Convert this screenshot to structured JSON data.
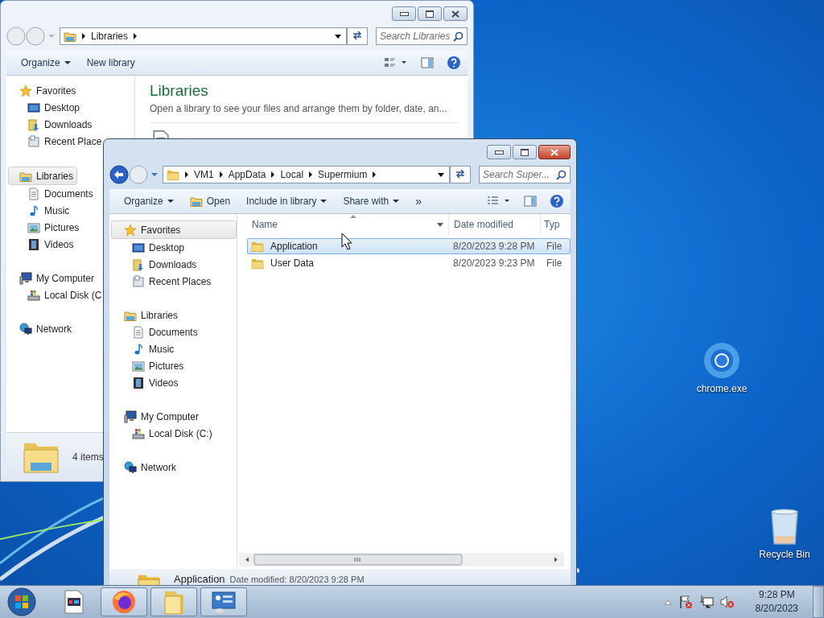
{
  "back_window": {
    "address": {
      "segments": [
        "Libraries"
      ]
    },
    "search": {
      "placeholder": "Search Libraries"
    },
    "toolbar": [
      {
        "label": "Organize",
        "kind": "menu"
      },
      {
        "label": "New library",
        "kind": "plain"
      }
    ],
    "nav": [
      {
        "label": "Favorites",
        "kind": "star",
        "selected": false,
        "children": [
          {
            "label": "Desktop",
            "kind": "desktop",
            "selected": false
          },
          {
            "label": "Downloads",
            "kind": "downloads",
            "selected": false
          },
          {
            "label": "Recent Place",
            "kind": "recent",
            "selected": false
          }
        ]
      },
      {
        "label": "Libraries",
        "kind": "library",
        "selected": true,
        "children": [
          {
            "label": "Documents",
            "kind": "documents",
            "selected": false
          },
          {
            "label": "Music",
            "kind": "music",
            "selected": false
          },
          {
            "label": "Pictures",
            "kind": "pictures",
            "selected": false
          },
          {
            "label": "Videos",
            "kind": "videos",
            "selected": false
          }
        ]
      },
      {
        "label": "My Computer",
        "kind": "computer",
        "selected": false,
        "children": [
          {
            "label": "Local Disk (C",
            "kind": "disk",
            "selected": false
          }
        ]
      },
      {
        "label": "Network",
        "kind": "network",
        "selected": false
      }
    ],
    "heading": "Libraries",
    "description": "Open a library to see your files and arrange them by folder, date, an...",
    "status": "4 items"
  },
  "front_window": {
    "address": {
      "segments": [
        "VM1",
        "AppData",
        "Local",
        "Supermium"
      ]
    },
    "search": {
      "placeholder": "Search Super..."
    },
    "toolbar": [
      {
        "label": "Organize",
        "kind": "menu"
      },
      {
        "label": "Open",
        "kind": "open"
      },
      {
        "label": "Include in library",
        "kind": "menu"
      },
      {
        "label": "Share with",
        "kind": "menu"
      },
      {
        "label": "»",
        "kind": "more"
      }
    ],
    "nav": [
      {
        "label": "Favorites",
        "kind": "star",
        "selected": true,
        "children": [
          {
            "label": "Desktop",
            "kind": "desktop",
            "selected": false
          },
          {
            "label": "Downloads",
            "kind": "downloads",
            "selected": false
          },
          {
            "label": "Recent Places",
            "kind": "recent",
            "selected": false
          }
        ]
      },
      {
        "label": "Libraries",
        "kind": "library",
        "selected": false,
        "children": [
          {
            "label": "Documents",
            "kind": "documents",
            "selected": false
          },
          {
            "label": "Music",
            "kind": "music",
            "selected": false
          },
          {
            "label": "Pictures",
            "kind": "pictures",
            "selected": false
          },
          {
            "label": "Videos",
            "kind": "videos",
            "selected": false
          }
        ]
      },
      {
        "label": "My Computer",
        "kind": "computer",
        "selected": false,
        "children": [
          {
            "label": "Local Disk (C:)",
            "kind": "disk",
            "selected": false
          }
        ]
      },
      {
        "label": "Network",
        "kind": "network",
        "selected": false
      }
    ],
    "columns": [
      "Name",
      "Date modified",
      "Typ"
    ],
    "rows": [
      {
        "name": "Application",
        "date": "8/20/2023 9:28 PM",
        "type": "File",
        "selected": true
      },
      {
        "name": "User Data",
        "date": "8/20/2023 9:23 PM",
        "type": "File",
        "selected": false
      }
    ],
    "details": {
      "name": "Application",
      "info": "Date modified: 8/20/2023 9:28 PM"
    }
  },
  "desktop_icons": [
    {
      "label": "chrome.exe",
      "kind": "chrome"
    },
    {
      "label": "Recycle Bin",
      "kind": "recycle"
    }
  ],
  "taskbar": {
    "apps": [
      {
        "kind": "program",
        "running": false
      },
      {
        "kind": "firefox",
        "running": true
      },
      {
        "kind": "explorer",
        "running": true
      },
      {
        "kind": "control-panel",
        "running": true
      }
    ],
    "time": "9:28 PM",
    "date": "8/20/2023"
  }
}
